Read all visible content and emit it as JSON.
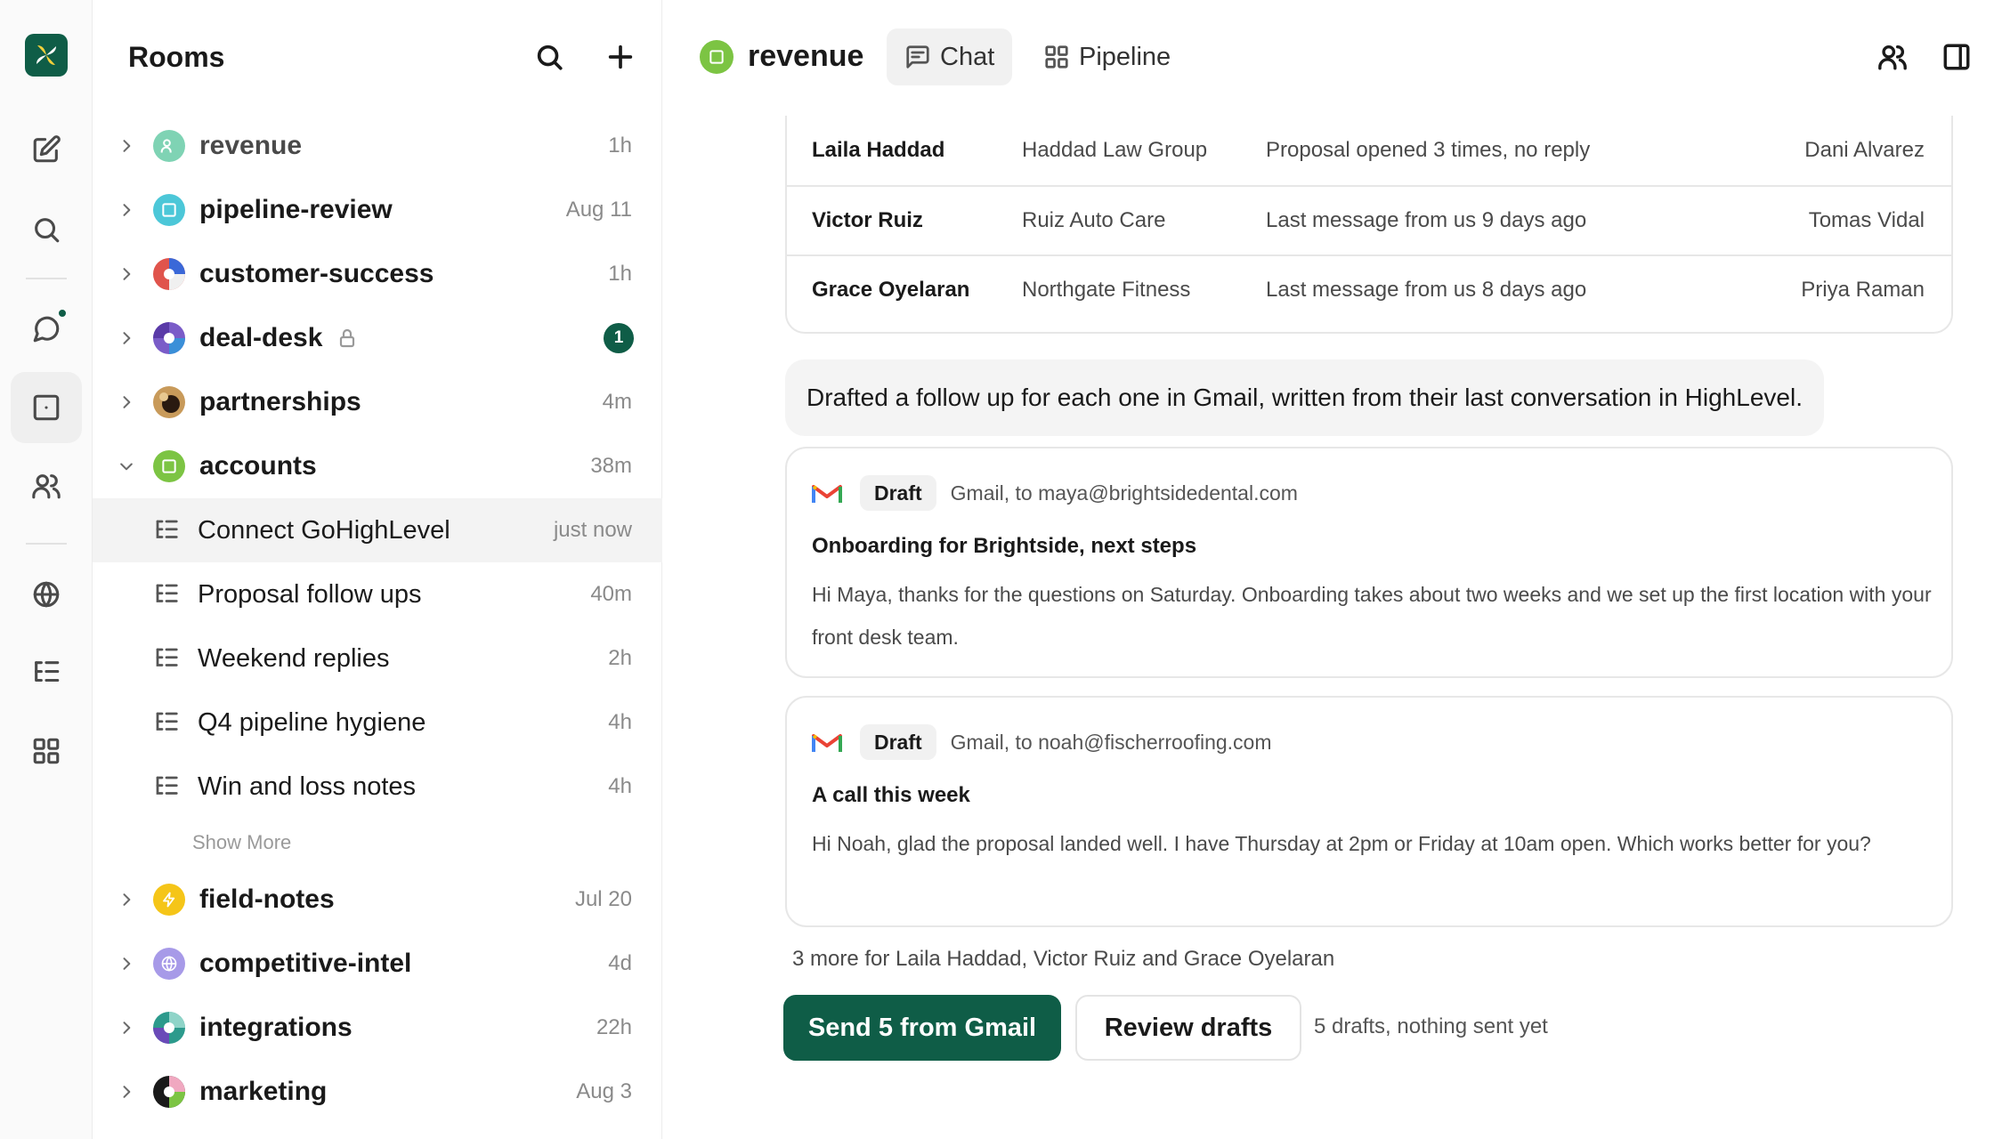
{
  "sidebar": {
    "title": "Rooms",
    "rooms": [
      {
        "name": "revenue",
        "time": "1h",
        "icon": "users-icon",
        "color": "#7fd3b4"
      },
      {
        "name": "pipeline-review",
        "time": "Aug 11",
        "icon": "square-dot-icon",
        "color": "#4cc7d8"
      },
      {
        "name": "customer-success",
        "time": "1h",
        "icon": "pinwheel-icon",
        "color": "#e0544c"
      },
      {
        "name": "deal-desk",
        "time": "",
        "badge": "1",
        "icon": "pinwheel-icon",
        "color": "#7a5cc8"
      },
      {
        "name": "partnerships",
        "time": "4m",
        "icon": "photo-avatar",
        "color": "#8a5a2b"
      },
      {
        "name": "accounts",
        "time": "38m",
        "icon": "square-dot-icon",
        "color": "#7cc443"
      }
    ],
    "threads": [
      {
        "name": "Connect GoHighLevel",
        "time": "just now"
      },
      {
        "name": "Proposal follow ups",
        "time": "40m"
      },
      {
        "name": "Weekend replies",
        "time": "2h"
      },
      {
        "name": "Q4 pipeline hygiene",
        "time": "4h"
      },
      {
        "name": "Win and loss notes",
        "time": "4h"
      }
    ],
    "show_more": "Show More",
    "rooms_after": [
      {
        "name": "field-notes",
        "time": "Jul 20",
        "icon": "bolt-icon",
        "color": "#f5c518"
      },
      {
        "name": "competitive-intel",
        "time": "4d",
        "icon": "globe-icon",
        "color": "#a79ae8"
      },
      {
        "name": "integrations",
        "time": "22h",
        "icon": "pinwheel-icon",
        "color": "#2c9a8c"
      },
      {
        "name": "marketing",
        "time": "Aug 3",
        "icon": "pinwheel-icon",
        "color": "#1a1a1a"
      }
    ]
  },
  "header": {
    "room": "revenue",
    "tabs": [
      "Chat",
      "Pipeline"
    ]
  },
  "table": {
    "rows": [
      [
        "Laila Haddad",
        "Haddad Law Group",
        "Proposal opened 3 times, no reply",
        "Dani Alvarez"
      ],
      [
        "Victor Ruiz",
        "Ruiz Auto Care",
        "Last message from us 9 days ago",
        "Tomas Vidal"
      ],
      [
        "Grace Oyelaran",
        "Northgate Fitness",
        "Last message from us 8 days ago",
        "Priya Raman"
      ]
    ]
  },
  "message": "Drafted a follow up for each one in Gmail, written from their last conversation in HighLevel.",
  "drafts": [
    {
      "pill": "Draft",
      "to": "Gmail, to maya@brightsidedental.com",
      "subject": "Onboarding for Brightside, next steps",
      "body": "Hi Maya, thanks for the questions on Saturday. Onboarding takes about two weeks and we set up the first location with your front desk team."
    },
    {
      "pill": "Draft",
      "to": "Gmail, to noah@fischerroofing.com",
      "subject": "A call this week",
      "body": "Hi Noah, glad the proposal landed well. I have Thursday at 2pm or Friday at 10am open. Which works better for you?"
    }
  ],
  "more_text": "3 more for Laila Haddad, Victor Ruiz and Grace Oyelaran",
  "actions": {
    "send": "Send 5 from Gmail",
    "review": "Review drafts",
    "note": "5 drafts, nothing sent yet"
  },
  "colors": {
    "brand": "#0f5d47"
  }
}
